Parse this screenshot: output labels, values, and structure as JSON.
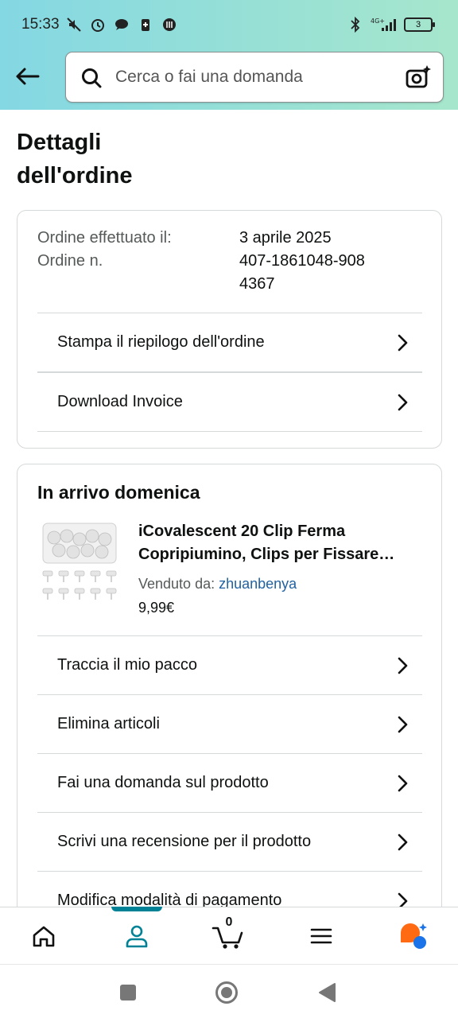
{
  "status_bar": {
    "time": "15:33",
    "battery": "3",
    "network": "4G+"
  },
  "header": {
    "search_placeholder": "Cerca o fai una domanda"
  },
  "page": {
    "title": "Dettagli dell'ordine"
  },
  "order_info": {
    "placed_label": "Ordine effettuato il:",
    "placed_value": "3 aprile 2025",
    "number_label": "Ordine n.",
    "number_value": "407-1861048-9084367"
  },
  "order_actions": [
    {
      "label": "Stampa il riepilogo dell'ordine"
    },
    {
      "label": "Download Invoice"
    }
  ],
  "shipment": {
    "title": "In arrivo domenica",
    "product_title": "iCovalescent 20 Clip Ferma Copripiumino, Clips per Fissare…",
    "seller_label": "Venduto da:",
    "seller_name": "zhuanbenya",
    "price": "9,99€",
    "actions": [
      {
        "label": "Traccia il mio pacco"
      },
      {
        "label": "Elimina articoli"
      },
      {
        "label": "Fai una domanda sul prodotto"
      },
      {
        "label": "Scrivi una recensione per il prodotto"
      },
      {
        "label": "Modifica modalità di pagamento"
      }
    ]
  },
  "bottom_nav": {
    "cart_count": "0"
  },
  "colors": {
    "accent": "#008296",
    "link": "#2162a1",
    "header_gradient_start": "#84d8e3",
    "header_gradient_end": "#a6e6cc",
    "rufus_orange": "#ff6a13",
    "rufus_blue": "#1a73e8"
  }
}
